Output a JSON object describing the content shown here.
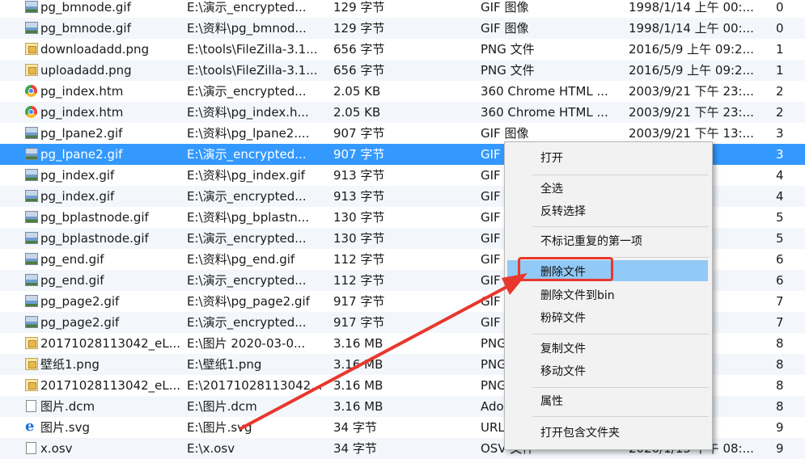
{
  "files": [
    {
      "icon": "gif",
      "name": "pg_bmnode.gif",
      "path": "E:\\演示_encrypted...",
      "size": "129 字节",
      "type": "GIF 图像",
      "date": "1998/1/14 上午 00:...",
      "count": "0"
    },
    {
      "icon": "gif",
      "name": "pg_bmnode.gif",
      "path": "E:\\资料\\pg_bmnod...",
      "size": "129 字节",
      "type": "GIF 图像",
      "date": "1998/1/14 上午 00:...",
      "count": "0"
    },
    {
      "icon": "png",
      "name": "downloadadd.png",
      "path": "E:\\tools\\FileZilla-3.1...",
      "size": "656 字节",
      "type": "PNG 文件",
      "date": "2016/5/9 上午 09:2...",
      "count": "1"
    },
    {
      "icon": "png",
      "name": "uploadadd.png",
      "path": "E:\\tools\\FileZilla-3.1...",
      "size": "656 字节",
      "type": "PNG 文件",
      "date": "2016/5/9 上午 09:2...",
      "count": "1"
    },
    {
      "icon": "htm",
      "name": "pg_index.htm",
      "path": "E:\\演示_encrypted...",
      "size": "2.05 KB",
      "type": "360 Chrome HTML ...",
      "date": "2003/9/21 下午 23:...",
      "count": "2"
    },
    {
      "icon": "htm",
      "name": "pg_index.htm",
      "path": "E:\\资料\\pg_index.h...",
      "size": "2.05 KB",
      "type": "360 Chrome HTML ...",
      "date": "2003/9/21 下午 23:...",
      "count": "2"
    },
    {
      "icon": "gif",
      "name": "pg_lpane2.gif",
      "path": "E:\\资料\\pg_lpane2....",
      "size": "907 字节",
      "type": "GIF 图像",
      "date": "2003/9/21 下午 13:...",
      "count": "3"
    },
    {
      "icon": "gif",
      "name": "pg_lpane2.gif",
      "path": "E:\\演示_encrypted...",
      "size": "907 字节",
      "type": "GIF",
      "date": "午 13:...",
      "count": "3",
      "selected": true
    },
    {
      "icon": "gif",
      "name": "pg_index.gif",
      "path": "E:\\资料\\pg_index.gif",
      "size": "913 字节",
      "type": "GIF",
      "date": "午 13:...",
      "count": "4"
    },
    {
      "icon": "gif",
      "name": "pg_index.gif",
      "path": "E:\\演示_encrypted...",
      "size": "913 字节",
      "type": "GIF",
      "date": "午 13:...",
      "count": "4"
    },
    {
      "icon": "gif",
      "name": "pg_bplastnode.gif",
      "path": "E:\\资料\\pg_bplastn...",
      "size": "130 字节",
      "type": "GIF",
      "date": "午 23:...",
      "count": "5"
    },
    {
      "icon": "gif",
      "name": "pg_bplastnode.gif",
      "path": "E:\\演示_encrypted...",
      "size": "130 字节",
      "type": "GIF",
      "date": "午 23:...",
      "count": "5"
    },
    {
      "icon": "gif",
      "name": "pg_end.gif",
      "path": "E:\\资料\\pg_end.gif",
      "size": "112 字节",
      "type": "GIF",
      "date": "午 14:...",
      "count": "6"
    },
    {
      "icon": "gif",
      "name": "pg_end.gif",
      "path": "E:\\演示_encrypted...",
      "size": "112 字节",
      "type": "GIF",
      "date": "午 14:...",
      "count": "6"
    },
    {
      "icon": "gif",
      "name": "pg_page2.gif",
      "path": "E:\\资料\\pg_page2.gif",
      "size": "917 字节",
      "type": "GIF",
      "date": "午 14:...",
      "count": "7"
    },
    {
      "icon": "gif",
      "name": "pg_page2.gif",
      "path": "E:\\演示_encrypted...",
      "size": "917 字节",
      "type": "GIF",
      "date": "午 14:...",
      "count": "7"
    },
    {
      "icon": "png",
      "name": "20171028113042_eL...",
      "path": "E:\\图片 2020-03-0...",
      "size": "3.16 MB",
      "type": "PNG",
      "date": "下午 1...",
      "count": "8"
    },
    {
      "icon": "png",
      "name": "壁纸1.png",
      "path": "E:\\壁纸1.png",
      "size": "3.16 MB",
      "type": "PNG",
      "date": "下午 1...",
      "count": "8"
    },
    {
      "icon": "png",
      "name": "20171028113042_eL...",
      "path": "E:\\20171028113042...",
      "size": "3.16 MB",
      "type": "PNG",
      "date": "午 13:...",
      "count": "8"
    },
    {
      "icon": "dcm",
      "name": "图片.dcm",
      "path": "E:\\图片.dcm",
      "size": "3.16 MB",
      "type": "Ado",
      "date": "下午 1...",
      "count": "8"
    },
    {
      "icon": "svg",
      "name": "图片.svg",
      "path": "E:\\图片.svg",
      "size": "34 字节",
      "type": "URL",
      "date": "午 08:...",
      "count": "9"
    },
    {
      "icon": "osv",
      "name": "x.osv",
      "path": "E:\\x.osv",
      "size": "34 字节",
      "type": "OSV 文件",
      "date": "2020/1/15 下午 08:...",
      "count": "9"
    }
  ],
  "context_menu": {
    "open": "打开",
    "select_all": "全选",
    "invert_selection": "反转选择",
    "unmark_first_duplicate": "不标记重复的第一项",
    "delete_file": "删除文件",
    "delete_to_bin": "删除文件到bin",
    "shred_file": "粉碎文件",
    "copy_file": "复制文件",
    "move_file": "移动文件",
    "properties": "属性",
    "open_containing_folder": "打开包含文件夹"
  },
  "colors": {
    "selection": "#3399ff",
    "menu_highlight": "#91c9f7",
    "annotation_red": "#e8372c"
  }
}
